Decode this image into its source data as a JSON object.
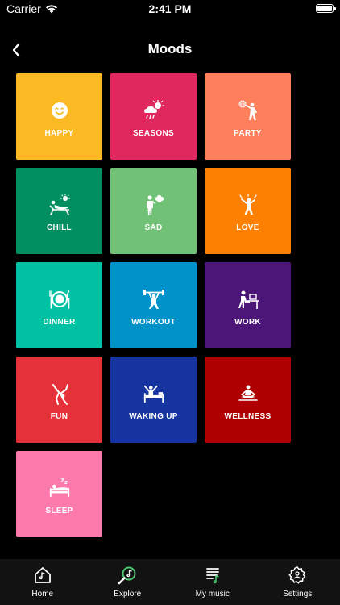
{
  "status_bar": {
    "carrier": "Carrier",
    "time": "2:41 PM"
  },
  "header": {
    "title": "Moods",
    "back_icon": "chevron-left-icon"
  },
  "moods": [
    {
      "label": "HAPPY",
      "icon": "smiley-icon",
      "color": "#FBB924"
    },
    {
      "label": "SEASONS",
      "icon": "weather-icon",
      "color": "#E0285E"
    },
    {
      "label": "PARTY",
      "icon": "disco-dancer-icon",
      "color": "#FD7F5C"
    },
    {
      "label": "CHILL",
      "icon": "sunbather-icon",
      "color": "#018F61"
    },
    {
      "label": "SAD",
      "icon": "thinking-person-icon",
      "color": "#71C276"
    },
    {
      "label": "LOVE",
      "icon": "celebrating-person-icon",
      "color": "#FE8003"
    },
    {
      "label": "DINNER",
      "icon": "plate-cutlery-icon",
      "color": "#00C1A3"
    },
    {
      "label": "WORKOUT",
      "icon": "weightlifter-icon",
      "color": "#0092C9"
    },
    {
      "label": "WORK",
      "icon": "desk-worker-icon",
      "color": "#4C1578"
    },
    {
      "label": "FUN",
      "icon": "cartwheel-icon",
      "color": "#E5323A"
    },
    {
      "label": "WAKING UP",
      "icon": "waking-person-icon",
      "color": "#1534A0"
    },
    {
      "label": "WELLNESS",
      "icon": "meditation-icon",
      "color": "#AF0102"
    },
    {
      "label": "SLEEP",
      "icon": "sleeping-person-icon",
      "color": "#FB79AB"
    }
  ],
  "tabs": [
    {
      "label": "Home",
      "icon": "home-icon"
    },
    {
      "label": "Explore",
      "icon": "explore-search-icon",
      "accent": "#4CC66F"
    },
    {
      "label": "My music",
      "icon": "playlist-icon",
      "accent": "#4CC66F"
    },
    {
      "label": "Settings",
      "icon": "gear-icon"
    }
  ]
}
